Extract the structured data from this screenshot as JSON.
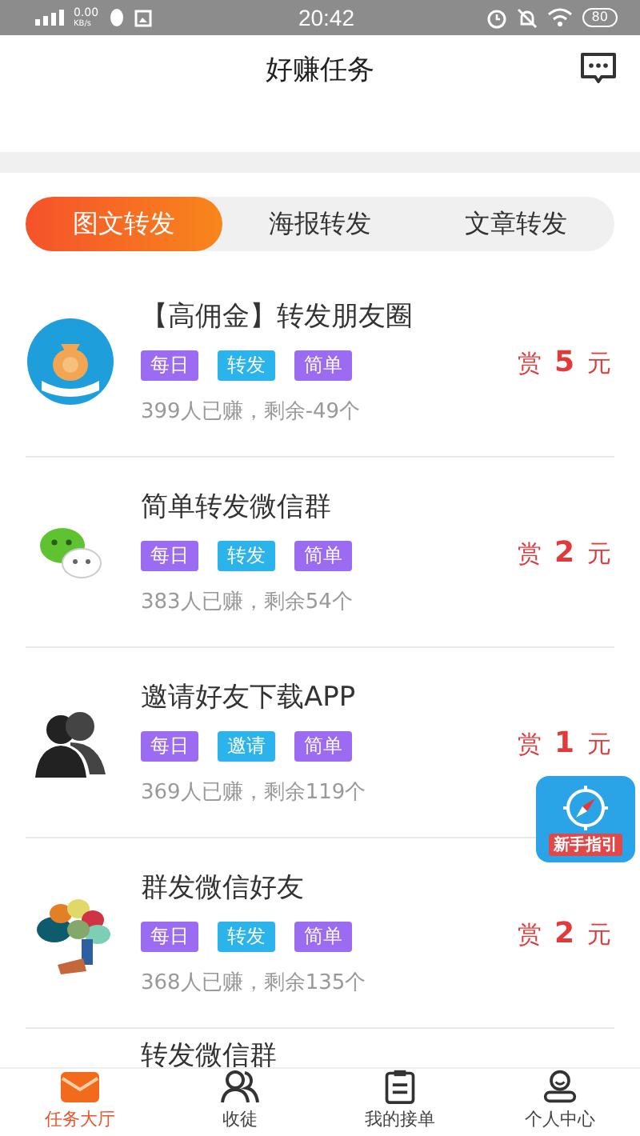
{
  "status_bar": {
    "speed": "0.00",
    "speed_unit": "KB/s",
    "time": "20:42",
    "battery": "80"
  },
  "header": {
    "title": "好赚任务"
  },
  "tabs": [
    {
      "label": "图文转发",
      "selected": true
    },
    {
      "label": "海报转发",
      "selected": false
    },
    {
      "label": "文章转发",
      "selected": false
    }
  ],
  "tasks": [
    {
      "kind": "money-bag",
      "title": "【高佣金】转发朋友圈",
      "tags": [
        {
          "label": "每日",
          "color": "#9b6bf2"
        },
        {
          "label": "转发",
          "color": "#2bb3ec"
        },
        {
          "label": "简单",
          "color": "#9b6bf2"
        }
      ],
      "reward_prefix": "赏",
      "reward": "5",
      "reward_unit": "元",
      "stats": "399人已赚，剩余-49个"
    },
    {
      "kind": "chat",
      "title": "简单转发微信群",
      "tags": [
        {
          "label": "每日",
          "color": "#9b6bf2"
        },
        {
          "label": "转发",
          "color": "#2bb3ec"
        },
        {
          "label": "简单",
          "color": "#9b6bf2"
        }
      ],
      "reward_prefix": "赏",
      "reward": "2",
      "reward_unit": "元",
      "stats": "383人已赚，剩余54个"
    },
    {
      "kind": "people",
      "title": "邀请好友下载APP",
      "tags": [
        {
          "label": "每日",
          "color": "#9b6bf2"
        },
        {
          "label": "邀请",
          "color": "#2bb3ec"
        },
        {
          "label": "简单",
          "color": "#9b6bf2"
        }
      ],
      "reward_prefix": "赏",
      "reward": "1",
      "reward_unit": "元",
      "stats": "369人已赚，剩余119个"
    },
    {
      "kind": "tree",
      "title": "群发微信好友",
      "tags": [
        {
          "label": "每日",
          "color": "#9b6bf2"
        },
        {
          "label": "转发",
          "color": "#2bb3ec"
        },
        {
          "label": "简单",
          "color": "#9b6bf2"
        }
      ],
      "reward_prefix": "赏",
      "reward": "2",
      "reward_unit": "元",
      "stats": "368人已赚，剩余135个"
    }
  ],
  "partial_task": {
    "title": "转发微信群"
  },
  "guide_button": {
    "label": "新手指引"
  },
  "bottom_nav": [
    {
      "kind": "mail",
      "label": "任务大厅",
      "selected": true
    },
    {
      "kind": "users",
      "label": "收徒",
      "selected": false
    },
    {
      "kind": "clipboard",
      "label": "我的接单",
      "selected": false
    },
    {
      "kind": "person",
      "label": "个人中心",
      "selected": false
    }
  ]
}
